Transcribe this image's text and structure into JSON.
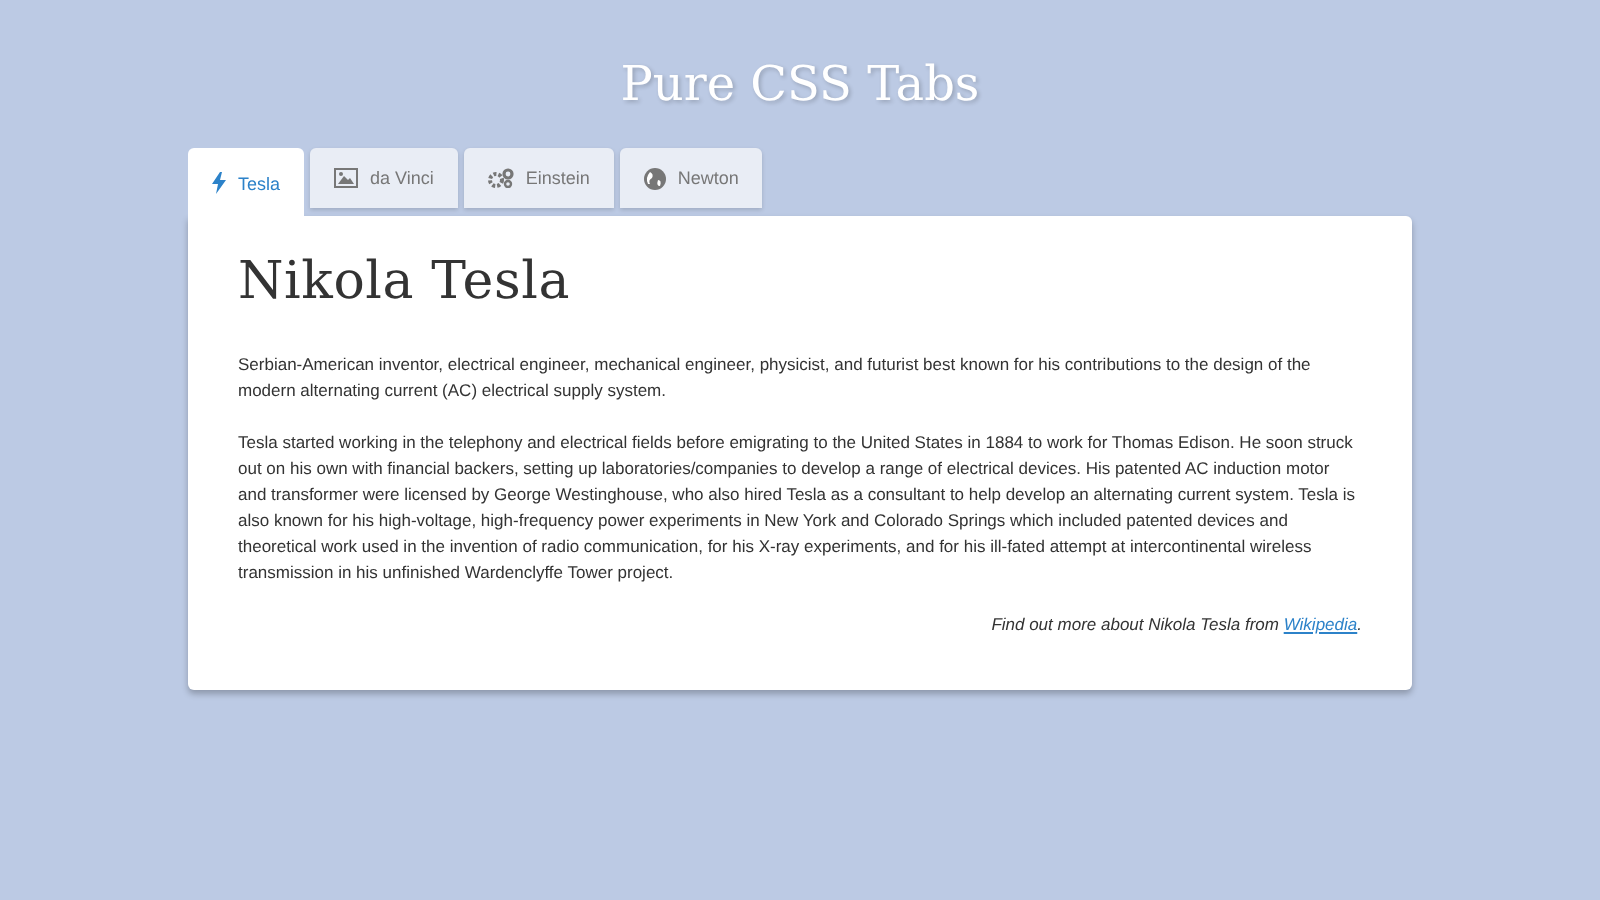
{
  "title": "Pure CSS Tabs",
  "tabs": [
    {
      "label": "Tesla",
      "selected": true
    },
    {
      "label": "da Vinci",
      "selected": false
    },
    {
      "label": "Einstein",
      "selected": false
    },
    {
      "label": "Newton",
      "selected": false
    }
  ],
  "panel": {
    "heading": "Nikola Tesla",
    "paragraphs": [
      "Serbian-American inventor, electrical engineer, mechanical engineer, physicist, and futurist best known for his contributions to the design of the modern alternating current (AC) electrical supply system.",
      "Tesla started working in the telephony and electrical fields before emigrating to the United States in 1884 to work for Thomas Edison. He soon struck out on his own with financial backers, setting up laboratories/companies to develop a range of electrical devices. His patented AC induction motor and transformer were licensed by George Westinghouse, who also hired Tesla as a consultant to help develop an alternating current system. Tesla is also known for his high-voltage, high-frequency power experiments in New York and Colorado Springs which included patented devices and theoretical work used in the invention of radio communication, for his X-ray experiments, and for his ill-fated attempt at intercontinental wireless transmission in his unfinished Wardenclyffe Tower project."
    ],
    "footer": {
      "text": "Find out more about Nikola Tesla from ",
      "link": "Wikipedia",
      "end": "."
    }
  }
}
